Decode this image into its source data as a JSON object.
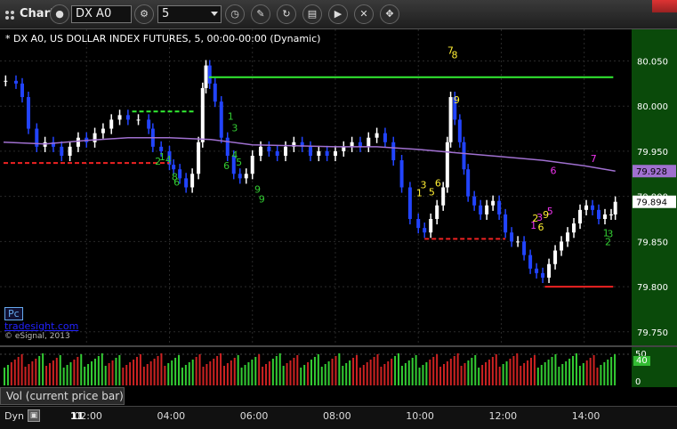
{
  "toolbar": {
    "app_title": "Chart",
    "symbol": "DX A0",
    "interval": "5",
    "icons": [
      "chart-dots-icon",
      "symbol-search-icon",
      "interval-settings-icon",
      "clock-icon",
      "pencil-icon",
      "refresh-icon",
      "chart-template-icon",
      "play-icon",
      "close-x-icon",
      "tools-icon"
    ]
  },
  "chart_header": "* DX A0, US DOLLAR INDEX FUTURES, 5, 00:00-00:00 (Dynamic)",
  "watermark": {
    "logo": "Pc",
    "site": "tradesight.com",
    "copyright": "© eSignal, 2013"
  },
  "volume_panel": {
    "label": "Vol (current price bar)",
    "ticks": [
      "50",
      "0"
    ],
    "current": "40"
  },
  "footer": {
    "mode": "Dyn",
    "date_label": "11",
    "time_ticks": [
      "02:00",
      "04:00",
      "06:00",
      "08:00",
      "10:00",
      "12:00",
      "14:00"
    ]
  },
  "colors": {
    "up": "#ffffff",
    "down": "#2244ff",
    "ma": "#a070d0",
    "resistance": "#33ee33",
    "support": "#ee2222",
    "seq_yellow": "#ffee33",
    "seq_green": "#33cc33",
    "seq_magenta": "#ee33ee",
    "axis_bg": "#0a4a0a"
  },
  "chart_data": {
    "type": "line",
    "title": "* DX A0, US DOLLAR INDEX FUTURES, 5, 00:00-00:00 (Dynamic)",
    "ylim": [
      79.735,
      80.085
    ],
    "yticks": [
      "80.050",
      "80.000",
      "79.950",
      "79.900",
      "79.850",
      "79.800",
      "79.750"
    ],
    "xlabel": "",
    "ylabel": "",
    "x_ticks": [
      "02:00",
      "04:00",
      "06:00",
      "08:00",
      "10:00",
      "12:00",
      "14:00"
    ],
    "x_tick_hours": [
      2,
      4,
      6,
      8,
      10,
      12,
      14
    ],
    "x_range_hours": [
      0.0,
      14.8
    ],
    "price_tags": [
      {
        "label": "79.928",
        "value": 79.928,
        "color": "#a070d0"
      },
      {
        "label": "79.894",
        "value": 79.894,
        "color": "#ffffff"
      }
    ],
    "price": [
      [
        0.05,
        80.028
      ],
      [
        0.3,
        80.025
      ],
      [
        0.45,
        80.01
      ],
      [
        0.6,
        79.975
      ],
      [
        0.8,
        79.955
      ],
      [
        1.0,
        79.96
      ],
      [
        1.2,
        79.955
      ],
      [
        1.4,
        79.945
      ],
      [
        1.6,
        79.955
      ],
      [
        1.8,
        79.965
      ],
      [
        2.0,
        79.96
      ],
      [
        2.2,
        79.97
      ],
      [
        2.4,
        79.975
      ],
      [
        2.6,
        79.985
      ],
      [
        2.8,
        79.99
      ],
      [
        3.0,
        79.985
      ],
      [
        3.25,
        79.985
      ],
      [
        3.5,
        79.975
      ],
      [
        3.6,
        79.955
      ],
      [
        3.8,
        79.95
      ],
      [
        4.0,
        79.935
      ],
      [
        4.1,
        79.93
      ],
      [
        4.25,
        79.92
      ],
      [
        4.4,
        79.91
      ],
      [
        4.55,
        79.925
      ],
      [
        4.7,
        79.96
      ],
      [
        4.8,
        80.02
      ],
      [
        4.88,
        80.045
      ],
      [
        4.97,
        80.025
      ],
      [
        5.1,
        80.005
      ],
      [
        5.25,
        79.965
      ],
      [
        5.4,
        79.945
      ],
      [
        5.55,
        79.925
      ],
      [
        5.7,
        79.92
      ],
      [
        5.85,
        79.925
      ],
      [
        6.0,
        79.945
      ],
      [
        6.2,
        79.955
      ],
      [
        6.4,
        79.95
      ],
      [
        6.6,
        79.945
      ],
      [
        6.8,
        79.955
      ],
      [
        7.0,
        79.96
      ],
      [
        7.2,
        79.955
      ],
      [
        7.4,
        79.945
      ],
      [
        7.6,
        79.95
      ],
      [
        7.8,
        79.945
      ],
      [
        8.0,
        79.95
      ],
      [
        8.2,
        79.955
      ],
      [
        8.4,
        79.96
      ],
      [
        8.6,
        79.955
      ],
      [
        8.8,
        79.965
      ],
      [
        9.0,
        79.97
      ],
      [
        9.2,
        79.96
      ],
      [
        9.4,
        79.94
      ],
      [
        9.6,
        79.91
      ],
      [
        9.8,
        79.875
      ],
      [
        10.0,
        79.865
      ],
      [
        10.15,
        79.86
      ],
      [
        10.3,
        79.875
      ],
      [
        10.45,
        79.89
      ],
      [
        10.6,
        79.91
      ],
      [
        10.7,
        79.96
      ],
      [
        10.78,
        80.01
      ],
      [
        10.88,
        79.985
      ],
      [
        11.0,
        79.96
      ],
      [
        11.1,
        79.93
      ],
      [
        11.2,
        79.9
      ],
      [
        11.35,
        79.89
      ],
      [
        11.5,
        79.88
      ],
      [
        11.65,
        79.89
      ],
      [
        11.8,
        79.895
      ],
      [
        11.95,
        79.88
      ],
      [
        12.1,
        79.86
      ],
      [
        12.25,
        79.85
      ],
      [
        12.4,
        79.85
      ],
      [
        12.55,
        79.835
      ],
      [
        12.7,
        79.82
      ],
      [
        12.85,
        79.815
      ],
      [
        13.0,
        79.81
      ],
      [
        13.15,
        79.825
      ],
      [
        13.3,
        79.84
      ],
      [
        13.45,
        79.85
      ],
      [
        13.6,
        79.86
      ],
      [
        13.75,
        79.87
      ],
      [
        13.9,
        79.885
      ],
      [
        14.05,
        79.89
      ],
      [
        14.2,
        79.885
      ],
      [
        14.35,
        79.875
      ],
      [
        14.5,
        79.88
      ],
      [
        14.65,
        79.88
      ],
      [
        14.75,
        79.894
      ]
    ],
    "series": [
      {
        "name": "",
        "color": "#a070d0",
        "x": [
          0,
          1,
          2,
          3,
          4,
          5,
          6,
          7,
          8,
          9,
          10,
          11,
          12,
          13,
          14,
          14.75
        ],
        "y": [
          79.96,
          79.958,
          79.962,
          79.965,
          79.965,
          79.963,
          79.957,
          79.956,
          79.955,
          79.955,
          79.952,
          79.948,
          79.944,
          79.94,
          79.934,
          79.928
        ]
      }
    ],
    "levels": [
      {
        "name": "resistance",
        "value": 80.032,
        "x_start": 4.95,
        "x_end": 14.7,
        "color": "#33ee33",
        "dash": false
      },
      {
        "name": "support-1",
        "value": 79.937,
        "x_start": 0.0,
        "x_end": 4.0,
        "color": "#ee2222",
        "dash": true
      },
      {
        "name": "support-2",
        "value": 79.853,
        "x_start": 10.15,
        "x_end": 12.1,
        "color": "#ee2222",
        "dash": true
      },
      {
        "name": "support-3",
        "value": 79.8,
        "x_start": 13.05,
        "x_end": 14.7,
        "color": "#ee2222",
        "dash": false
      },
      {
        "name": "green-dash",
        "value": 79.994,
        "x_start": 3.1,
        "x_end": 4.6,
        "color": "#33ee33",
        "dash": true
      }
    ],
    "annotations": [
      {
        "text": "7",
        "x": 10.7,
        "y": 80.058,
        "color": "#ffee33"
      },
      {
        "text": "8",
        "x": 10.8,
        "y": 80.053,
        "color": "#ffee33"
      },
      {
        "text": "9",
        "x": 10.85,
        "y": 80.003,
        "color": "#ffee33"
      },
      {
        "text": "3",
        "x": 10.05,
        "y": 79.909,
        "color": "#ffee33"
      },
      {
        "text": "6",
        "x": 10.4,
        "y": 79.911,
        "color": "#ffee33"
      },
      {
        "text": "1",
        "x": 9.95,
        "y": 79.9,
        "color": "#ffee33"
      },
      {
        "text": "5",
        "x": 10.25,
        "y": 79.901,
        "color": "#ffee33"
      },
      {
        "text": "7",
        "x": 14.15,
        "y": 79.938,
        "color": "#ee33ee"
      },
      {
        "text": "6",
        "x": 13.18,
        "y": 79.925,
        "color": "#ee33ee"
      },
      {
        "text": "5",
        "x": 13.1,
        "y": 79.88,
        "color": "#ee33ee"
      },
      {
        "text": "3",
        "x": 12.85,
        "y": 79.873,
        "color": "#ee33ee"
      },
      {
        "text": "1",
        "x": 12.7,
        "y": 79.864,
        "color": "#ee33ee"
      },
      {
        "text": "2",
        "x": 12.75,
        "y": 79.872,
        "color": "#ffee33"
      },
      {
        "text": "9",
        "x": 13.0,
        "y": 79.876,
        "color": "#ffee33"
      },
      {
        "text": "6",
        "x": 12.88,
        "y": 79.862,
        "color": "#ffee33"
      },
      {
        "text": "1",
        "x": 14.45,
        "y": 79.856,
        "color": "#33cc33"
      },
      {
        "text": "3",
        "x": 14.55,
        "y": 79.855,
        "color": "#33cc33"
      },
      {
        "text": "2",
        "x": 14.5,
        "y": 79.846,
        "color": "#33cc33"
      },
      {
        "text": "1",
        "x": 5.4,
        "y": 79.985,
        "color": "#33cc33"
      },
      {
        "text": "3",
        "x": 5.5,
        "y": 79.972,
        "color": "#33cc33"
      },
      {
        "text": "4",
        "x": 5.5,
        "y": 79.942,
        "color": "#33cc33"
      },
      {
        "text": "5",
        "x": 5.6,
        "y": 79.934,
        "color": "#33cc33"
      },
      {
        "text": "6",
        "x": 5.3,
        "y": 79.93,
        "color": "#33cc33"
      },
      {
        "text": "9",
        "x": 6.05,
        "y": 79.904,
        "color": "#33cc33"
      },
      {
        "text": "9",
        "x": 6.15,
        "y": 79.893,
        "color": "#33cc33"
      },
      {
        "text": "1",
        "x": 3.75,
        "y": 79.94,
        "color": "#33cc33"
      },
      {
        "text": "2",
        "x": 3.65,
        "y": 79.935,
        "color": "#33cc33"
      },
      {
        "text": "4",
        "x": 3.9,
        "y": 79.937,
        "color": "#33cc33"
      },
      {
        "text": "6",
        "x": 4.1,
        "y": 79.912,
        "color": "#33cc33"
      },
      {
        "text": "8",
        "x": 4.05,
        "y": 79.918,
        "color": "#33cc33"
      }
    ]
  }
}
